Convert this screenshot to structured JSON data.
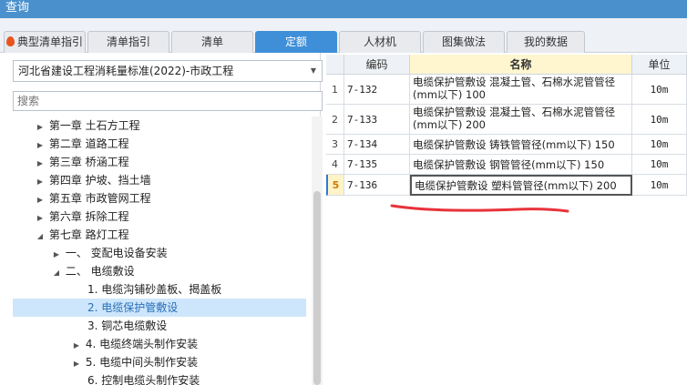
{
  "window": {
    "title": "查询"
  },
  "tabs": [
    {
      "label": "典型清单指引",
      "active": false,
      "has_fire_icon": true
    },
    {
      "label": "清单指引",
      "active": false
    },
    {
      "label": "清单",
      "active": false
    },
    {
      "label": "定额",
      "active": true
    },
    {
      "label": "人材机",
      "active": false
    },
    {
      "label": "图集做法",
      "active": false
    },
    {
      "label": "我的数据",
      "active": false
    }
  ],
  "left": {
    "standard_select": "河北省建设工程消耗量标准(2022)-市政工程",
    "search_placeholder": "搜索",
    "tree": [
      {
        "label": "第一章 土石方工程",
        "state": "collapsed"
      },
      {
        "label": "第二章 道路工程",
        "state": "collapsed"
      },
      {
        "label": "第三章 桥涵工程",
        "state": "collapsed"
      },
      {
        "label": "第四章 护坡、挡土墙",
        "state": "collapsed"
      },
      {
        "label": "第五章 市政管网工程",
        "state": "collapsed"
      },
      {
        "label": "第六章 拆除工程",
        "state": "collapsed"
      },
      {
        "label": "第七章 路灯工程",
        "state": "expanded"
      },
      {
        "label": "一、 变配电设备安装",
        "state": "collapsed"
      },
      {
        "label": "二、 电缆敷设",
        "state": "expanded"
      },
      {
        "label": "1. 电缆沟铺砂盖板、揭盖板",
        "state": "leaf"
      },
      {
        "label": "2. 电缆保护管敷设",
        "state": "leaf",
        "selected": true
      },
      {
        "label": "3. 铜芯电缆敷设",
        "state": "leaf"
      },
      {
        "label": "4. 电缆终端头制作安装",
        "state": "collapsed"
      },
      {
        "label": "5. 电缆中间头制作安装",
        "state": "collapsed"
      },
      {
        "label": "6. 控制电缆头制作安装",
        "state": "leaf"
      }
    ]
  },
  "grid": {
    "headers": {
      "code": "编码",
      "name": "名称",
      "unit": "单位"
    },
    "rows": [
      {
        "idx": "1",
        "code": "7-132",
        "name": "电缆保护管敷设 混凝土管、石棉水泥管管径(mm以下) 100",
        "unit": "10m"
      },
      {
        "idx": "2",
        "code": "7-133",
        "name": "电缆保护管敷设 混凝土管、石棉水泥管管径(mm以下) 200",
        "unit": "10m"
      },
      {
        "idx": "3",
        "code": "7-134",
        "name": "电缆保护管敷设 铸铁管管径(mm以下) 150",
        "unit": "10m"
      },
      {
        "idx": "4",
        "code": "7-135",
        "name": "电缆保护管敷设 钢管管径(mm以下) 150",
        "unit": "10m"
      },
      {
        "idx": "5",
        "code": "7-136",
        "name": "电缆保护管敷设 塑料管管径(mm以下) 200",
        "unit": "10m",
        "current": true
      }
    ]
  },
  "colors": {
    "accent": "#3f8fd8",
    "title_bar": "#4a90cc",
    "annotation": "#e8323a"
  }
}
